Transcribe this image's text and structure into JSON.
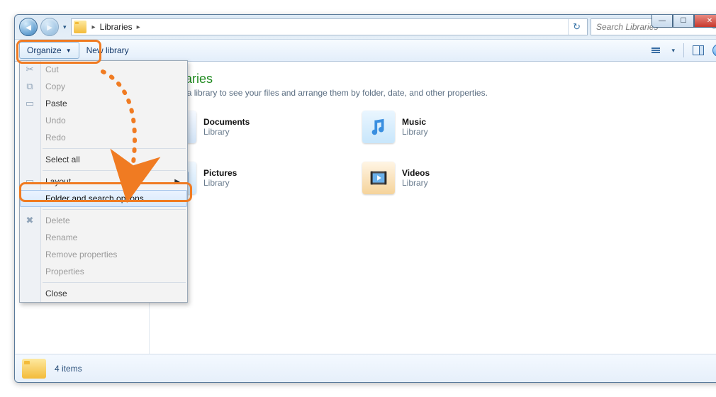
{
  "titlebar": {
    "minimize_glyph": "—",
    "maximize_glyph": "☐",
    "close_glyph": "✕"
  },
  "nav": {
    "back_glyph": "◄",
    "forward_glyph": "►",
    "history_glyph": "▾",
    "refresh_glyph": "↻"
  },
  "breadcrumb": {
    "root_chevron": "▸",
    "location": "Libraries",
    "trailing_chevron": "▸"
  },
  "search": {
    "placeholder": "Search Libraries",
    "icon": "🔍"
  },
  "toolbar": {
    "organize_label": "Organize",
    "organize_caret": "▼",
    "new_library_label": "New library",
    "help_glyph": "?"
  },
  "organize_menu": {
    "items": [
      {
        "label": "Cut",
        "icon": "✂",
        "disabled": true
      },
      {
        "label": "Copy",
        "icon": "⧉",
        "disabled": true
      },
      {
        "label": "Paste",
        "icon": "▭",
        "disabled": false
      },
      {
        "label": "Undo",
        "icon": "",
        "disabled": true
      },
      {
        "label": "Redo",
        "icon": "",
        "disabled": true
      }
    ],
    "sep1": true,
    "select_all": {
      "label": "Select all"
    },
    "sep2": true,
    "layout": {
      "label": "Layout",
      "submenu": true,
      "icon": "▭"
    },
    "folder_options": {
      "label": "Folder and search options"
    },
    "sep3": true,
    "tail": [
      {
        "label": "Delete",
        "icon": "✖",
        "disabled": true
      },
      {
        "label": "Rename",
        "icon": "",
        "disabled": true
      },
      {
        "label": "Remove properties",
        "icon": "",
        "disabled": true
      },
      {
        "label": "Properties",
        "icon": "",
        "disabled": true
      }
    ],
    "sep4": true,
    "close": {
      "label": "Close"
    }
  },
  "content": {
    "title": "Libraries",
    "subtitle": "Open a library to see your files and arrange them by folder, date, and other properties.",
    "libraries": [
      {
        "name": "Documents",
        "kind": "Library"
      },
      {
        "name": "Music",
        "kind": "Library"
      },
      {
        "name": "Pictures",
        "kind": "Library"
      },
      {
        "name": "Videos",
        "kind": "Library"
      }
    ]
  },
  "statusbar": {
    "count_text": "4 items"
  }
}
